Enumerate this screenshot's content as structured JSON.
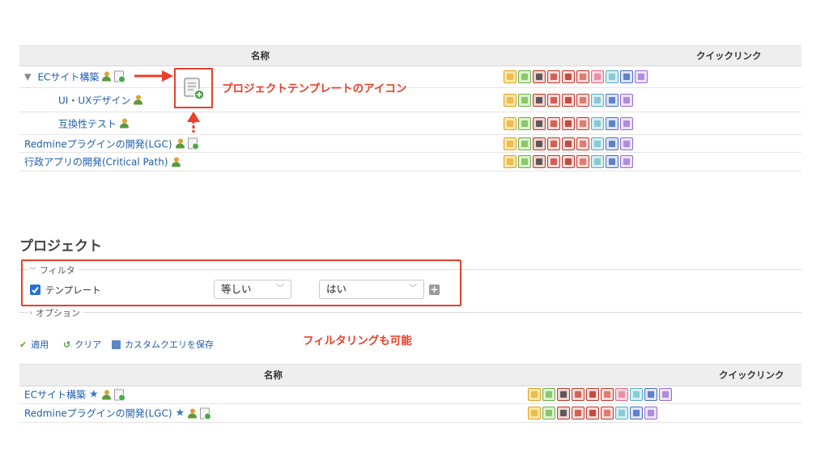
{
  "top_table": {
    "col_name": "名称",
    "col_quicklink": "クイックリンク",
    "rows": [
      {
        "name": "ECサイト構築",
        "indent": 0,
        "toggle": "▼",
        "template": true
      },
      {
        "name": "UI・UXデザイン",
        "indent": 1,
        "toggle": "",
        "template": false
      },
      {
        "name": "互換性テスト",
        "indent": 1,
        "toggle": "",
        "template": false
      },
      {
        "name": "Redmineプラグインの開発(LGC)",
        "indent": 0,
        "toggle": "",
        "template": true
      },
      {
        "name": "行政アプリの開発(Critical Path)",
        "indent": 0,
        "toggle": "",
        "template": false
      }
    ]
  },
  "annotation_icon": "プロジェクトテンプレートのアイコン",
  "annotation_filter": "フィルタリングも可能",
  "section_title": "プロジェクト",
  "filter": {
    "header": "フィルタ",
    "field_label": "テンプレート",
    "checked": true,
    "operator": "等しい",
    "value": "はい",
    "options_label": "オプション"
  },
  "actions": {
    "apply": "適用",
    "clear": "クリア",
    "save": "カスタムクエリを保存"
  },
  "bottom_table": {
    "col_name": "名称",
    "col_quicklink": "クイックリンク",
    "rows": [
      {
        "name": "ECサイト構築",
        "favorite": true
      },
      {
        "name": "Redmineプラグインの開発(LGC)",
        "favorite": true
      }
    ]
  },
  "colors": {
    "accent_red": "#e8402a",
    "link_blue": "#1f5ea8"
  }
}
